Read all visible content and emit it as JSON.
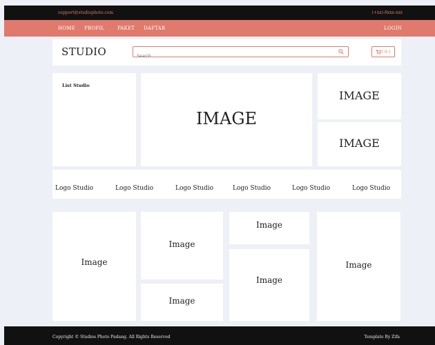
{
  "topbar": {
    "email": "support@studiophoto.com",
    "phone": "(+xx)-8xxx-xxx"
  },
  "nav": {
    "items": [
      "HOME",
      "PROFIL",
      "PAKET",
      "DAFTAR"
    ],
    "login": "LOGIN"
  },
  "header": {
    "brand": "STUDIO",
    "search_placeholder": "Search",
    "cart_label": "( 0 )"
  },
  "hero": {
    "list_title": "List Studio",
    "main_image": "IMAGE",
    "side_image_top": "IMAGE",
    "side_image_bottom": "IMAGE"
  },
  "logos": [
    "Logo Studio",
    "Logo Studio",
    "Logo Studio",
    "Logo Studio",
    "Logo Studio",
    "Logo Studio"
  ],
  "gallery": {
    "col1": "Image",
    "col2_top": "Image",
    "col2_bottom": "Image",
    "col3_top": "Image",
    "col3_bottom": "Image",
    "col4": "Image"
  },
  "footer": {
    "copyright": "Copyright © Studios Photo Padang. All Rights Reserved",
    "credit": "Template By Zifa"
  },
  "colors": {
    "accent": "#e07a6c",
    "dark": "#111111",
    "background": "#eef0f7"
  }
}
